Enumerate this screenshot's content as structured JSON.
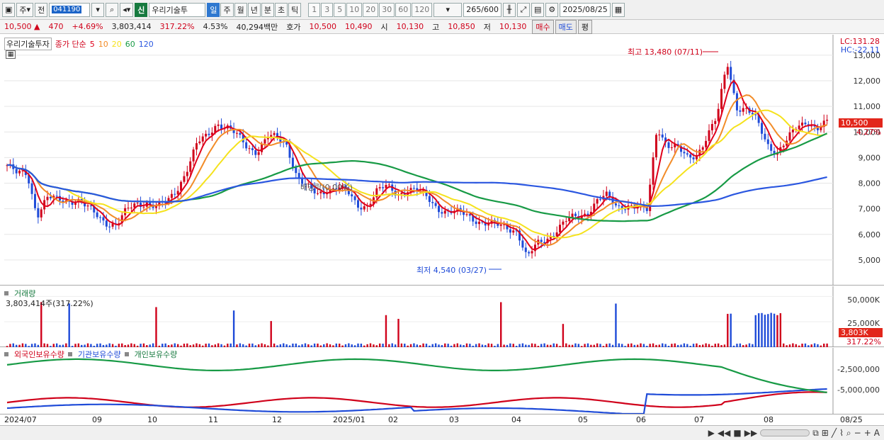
{
  "toolbar": {
    "market": "주",
    "view": "전",
    "code": "041190",
    "badge": "신",
    "stock_name": "우리기술투",
    "periods": [
      "일",
      "주",
      "월",
      "년",
      "분",
      "초",
      "틱"
    ],
    "active_period": "일",
    "ticks": [
      "1",
      "3",
      "5",
      "10",
      "20",
      "30",
      "60",
      "120"
    ],
    "count": "265",
    "count_max": "/600",
    "date": "2025/08/25"
  },
  "quote": {
    "price": "10,500",
    "arrow": "▲",
    "change": "470",
    "change_pct": "+4.69%",
    "volume": "3,803,414",
    "volume_ratio": "317.22%",
    "turnover": "4.53%",
    "amount": "40,294백만",
    "bid_label": "호가",
    "bid1": "10,500",
    "bid2": "10,490",
    "open_label": "시",
    "open": "10,130",
    "high_label": "고",
    "high": "10,850",
    "low_label": "저",
    "low": "10,130",
    "buy": "매수",
    "sell": "매도",
    "avg": "평"
  },
  "price_pane": {
    "title": "우리기술투자",
    "ma_label": "종가 단순",
    "ma_periods": [
      "5",
      "10",
      "20",
      "60",
      "120"
    ],
    "lc": "LC:131.28",
    "hc": "HC:-22.11",
    "y_ticks": [
      "13,000",
      "12,000",
      "11,000",
      "10,000",
      "9,000",
      "8,000",
      "7,000",
      "6,000",
      "5,000"
    ],
    "last_price": "10,500",
    "last_pct": "4.27%",
    "high_annot": "최고 13,480 (07/11)",
    "low_annot": "최저 4,540 (03/27)",
    "mid_label": "배당락(0.00%)"
  },
  "volume_pane": {
    "title": "거래량",
    "value": "3,803,414주(317.22%)",
    "y_ticks": [
      "50,000K",
      "25,000K"
    ],
    "last": "3,803K",
    "last_pct": "317.22%"
  },
  "holder_pane": {
    "series": [
      "외국인보유수량",
      "기관보유수량",
      "개인보유수량"
    ],
    "y_ticks": [
      "-2,500,000",
      "-5,000,000"
    ]
  },
  "x_ticks": [
    "2024/07",
    "09",
    "10",
    "11",
    "12",
    "2025/01",
    "02",
    "03",
    "04",
    "05",
    "06",
    "07",
    "08",
    "08/25"
  ],
  "colors": {
    "up": "#d0021b",
    "down": "#1f4bd8",
    "ma5": "#e0001b",
    "ma10": "#f28c28",
    "ma20": "#f5e21c",
    "ma60": "#179a45",
    "ma120": "#2b57e0"
  },
  "chart_data": {
    "type": "candlestick",
    "price_range": [
      4000,
      13800
    ],
    "price_points": [
      8700,
      8300,
      8400,
      6800,
      7400,
      7300,
      7350,
      7400,
      7000,
      6700,
      6500,
      6400,
      6900,
      7200,
      7300,
      7050,
      7200,
      7800,
      8600,
      9500,
      9800,
      10400,
      10200,
      9800,
      9400,
      9300,
      9800,
      9700,
      9500,
      8300,
      7800,
      7500,
      7800,
      7900,
      7600,
      7100,
      7200,
      7700,
      7800,
      7600,
      7800,
      7700,
      7400,
      7100,
      6900,
      6800,
      6750,
      6600,
      6400,
      6300,
      6300,
      6200,
      5000,
      5600,
      5900,
      6200,
      6500,
      6700,
      6900,
      7300,
      7450,
      7100,
      7200,
      7000,
      6900,
      10300,
      9500,
      9300,
      9000,
      9200,
      9800,
      10500,
      12800,
      11000,
      10800,
      10400,
      9600,
      9200,
      9600,
      10200,
      10500,
      10100,
      10300
    ],
    "volume_range": [
      0,
      60000
    ],
    "holders_range": [
      -6800000,
      200000
    ]
  }
}
